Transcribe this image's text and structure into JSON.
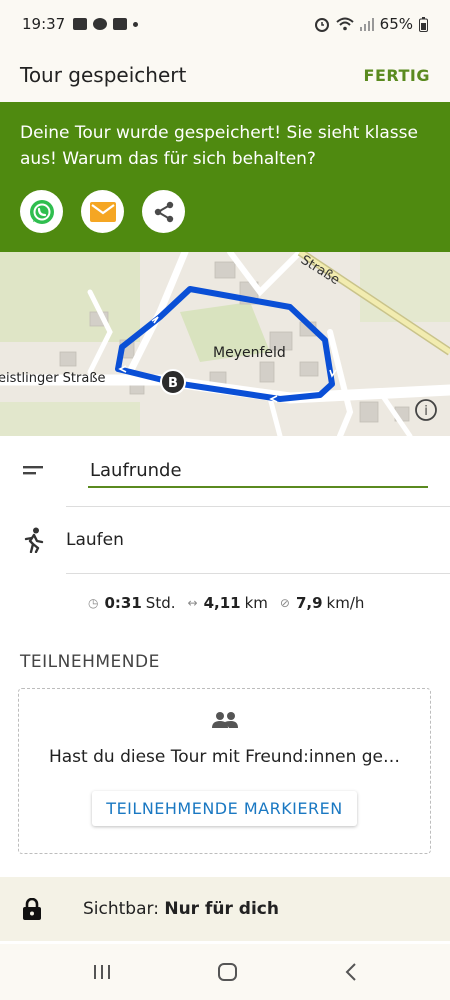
{
  "status_bar": {
    "time": "19:37",
    "battery": "65%"
  },
  "app_bar": {
    "title": "Tour gespeichert",
    "done_label": "FERTIG"
  },
  "banner": {
    "message": "Deine Tour wurde gespeichert! Sie sieht klasse aus! Warum das für sich behalten?",
    "share_buttons": [
      "whatsapp-icon",
      "email-icon",
      "share-icon"
    ],
    "color": "#4f8a10"
  },
  "map": {
    "place_label": "Meyenfeld",
    "street_left": "eistlinger Straße",
    "street_top": "Straße",
    "marker_label": "B",
    "route_color": "#0a4fd6"
  },
  "tour": {
    "name_value": "Laufrunde",
    "sport": "Laufen",
    "duration_value": "0:31",
    "duration_unit": "Std.",
    "distance_value": "4,11",
    "distance_unit": "km",
    "speed_value": "7,9",
    "speed_unit": "km/h"
  },
  "participants": {
    "section_title": "TEILNEHMENDE",
    "question": "Hast du diese Tour mit Freund:innen ge…",
    "button_label": "TEILNEHMENDE MARKIEREN"
  },
  "visibility": {
    "label": "Sichtbar:",
    "value": "Nur für dich"
  },
  "colors": {
    "accent": "#5a8a1f",
    "link": "#1a78c2"
  }
}
